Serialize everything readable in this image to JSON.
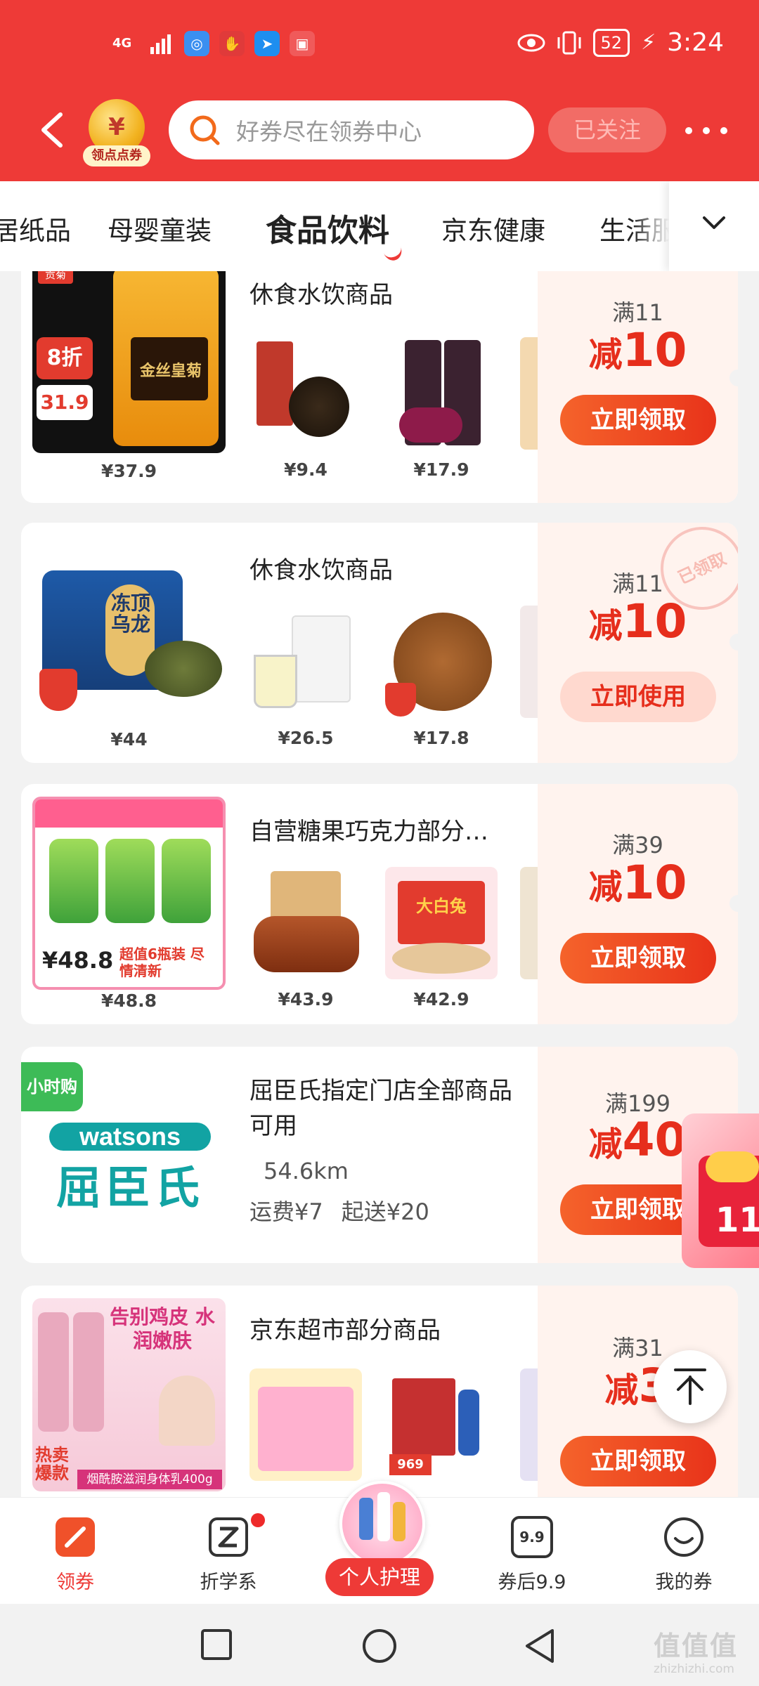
{
  "status_bar": {
    "network": "4G",
    "battery": "52",
    "time": "3:24"
  },
  "header": {
    "shop_logo_label": "领点点券",
    "shop_logo_coin": "¥",
    "search_placeholder": "好券尽在领券中心",
    "follow_label": "已关注"
  },
  "tabs": [
    {
      "label": "居纸品",
      "active": false
    },
    {
      "label": "母婴童装",
      "active": false
    },
    {
      "label": "食品饮料",
      "active": true
    },
    {
      "label": "京东健康",
      "active": false
    },
    {
      "label": "生活服",
      "active": false
    }
  ],
  "coupons": [
    {
      "title": "休食水饮商品",
      "main_price": "¥37.9",
      "thumbs": [
        {
          "price": "¥9.4"
        },
        {
          "price": "¥17.9"
        }
      ],
      "condition": "满11",
      "discount_prefix": "减",
      "discount_value": "10",
      "action": "立即领取",
      "main_img_badge": "8折",
      "main_img_price": "31.9",
      "main_img_brand": "金丝皇菊"
    },
    {
      "title": "休食水饮商品",
      "main_price": "¥44",
      "thumbs": [
        {
          "price": "¥26.5"
        },
        {
          "price": "¥17.8"
        }
      ],
      "condition": "满11",
      "discount_prefix": "减",
      "discount_value": "10",
      "action": "立即使用",
      "stamp": "已领取",
      "main_img_brand": "冻顶乌龙"
    },
    {
      "title": "自营糖果巧克力部分…",
      "main_price": "¥48.8",
      "thumbs": [
        {
          "price": "¥43.9"
        },
        {
          "price": "¥42.9"
        }
      ],
      "condition": "满39",
      "discount_prefix": "减",
      "discount_value": "10",
      "action": "立即领取",
      "main_img_price": "48.8",
      "main_img_slogan": "超值6瓶装 尽情清新",
      "thumb2_label": "大白兔"
    },
    {
      "badge": "小时购",
      "brand_en": "watsons",
      "brand_cn": "屈臣氏",
      "title": "屈臣氏指定门店全部商品可用",
      "distance": "54.6km",
      "shipping": "运费¥7",
      "min_order": "起送¥20",
      "condition": "满199",
      "discount_prefix": "减",
      "discount_value": "40",
      "action": "立即领取"
    },
    {
      "title": "京东超市部分商品",
      "condition": "满31",
      "discount_prefix": "减",
      "discount_value": "3",
      "action": "立即领取",
      "main_img_slogan": "告别鸡皮 水润嫩肤",
      "main_img_tag": "热卖爆款",
      "main_img_caption": "烟酰胺滋润身体乳400g",
      "thumb2_price": "969"
    }
  ],
  "bottom_nav": [
    {
      "label": "领券",
      "icon": "coupon-icon",
      "active": true
    },
    {
      "label": "折学系",
      "icon": "zhe-icon",
      "active": false
    },
    {
      "label": "个人护理",
      "icon": "personal-care-icon",
      "active": false
    },
    {
      "label": "券后9.9",
      "icon": "price-9-9-icon",
      "active": false
    },
    {
      "label": "我的券",
      "icon": "smile-icon",
      "active": false
    }
  ],
  "bottom_nav_icon_text": "9.9",
  "watermark": "值值值",
  "watermark_sub": "zhizhizhi.com",
  "colors": {
    "brand_red": "#ee3a37",
    "discount_red": "#e62e1c",
    "hour_badge_green": "#3dbb57",
    "watsons_teal": "#12a3a3"
  }
}
